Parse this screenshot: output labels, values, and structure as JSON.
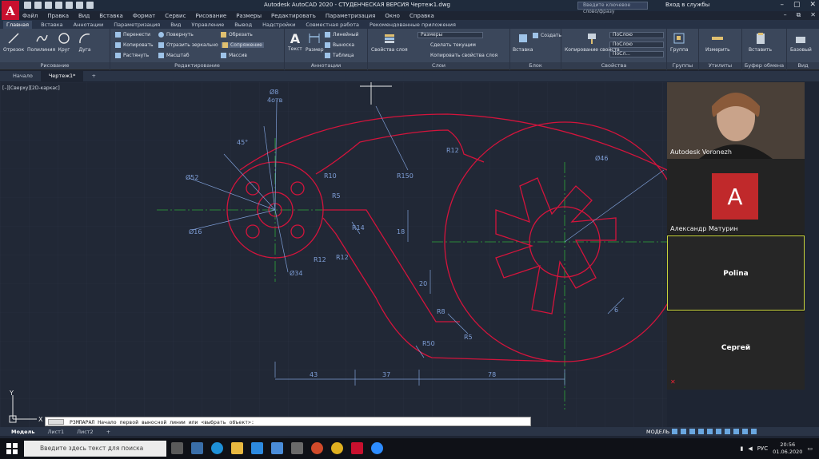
{
  "titlebar": {
    "title": "Autodesk AutoCAD 2020 - СТУДЕНЧЕСКАЯ ВЕРСИЯ    Чертеж1.dwg",
    "search_placeholder": "Введите ключевое слово/фразу",
    "signin": "Вход в службы",
    "logo": "A"
  },
  "menu": [
    "Файл",
    "Правка",
    "Вид",
    "Вставка",
    "Формат",
    "Сервис",
    "Рисование",
    "Размеры",
    "Редактировать",
    "Параметризация",
    "Окно",
    "Справка"
  ],
  "ribbon_tabs": [
    "Главная",
    "Вставка",
    "Аннотации",
    "Параметризация",
    "Вид",
    "Управление",
    "Вывод",
    "Надстройки",
    "Совместная работа",
    "Рекомендованные приложения"
  ],
  "ribbon": {
    "draw": {
      "label": "Рисование",
      "tools": [
        "Отрезок",
        "Полилиния",
        "Круг",
        "Дуга"
      ]
    },
    "modify": {
      "label": "Редактирование",
      "move": "Перенести",
      "rotate": "Повернуть",
      "trim": "Обрезать",
      "copy": "Копировать",
      "mirror": "Отразить зеркально",
      "fillet": "Сопряжение",
      "stretch": "Растянуть",
      "scale": "Масштаб",
      "array": "Массив"
    },
    "annotation": {
      "label": "Аннотации",
      "text": "Текст",
      "dimension": "Размер",
      "linear": "Линейный",
      "leader": "Выноска",
      "table": "Таблица"
    },
    "layers": {
      "label": "Слои",
      "props": "Свойства слоя",
      "dropdown": "Размеры",
      "make_current": "Сделать текущим",
      "match": "Копировать свойства слоя"
    },
    "block": {
      "label": "Блок",
      "insert": "Вставка",
      "create": "Создать"
    },
    "properties": {
      "label": "Свойства",
      "match": "Копирование свойств",
      "layer1": "ПоСлою",
      "layer2": "ПоСлою",
      "layer3": "ПоСл..."
    },
    "groups": {
      "label": "Группы",
      "group": "Группа"
    },
    "utilities": {
      "label": "Утилиты",
      "measure": "Измерить"
    },
    "clipboard": {
      "label": "Буфер обмена",
      "paste": "Вставить"
    },
    "view": {
      "label": "Вид",
      "base": "Базовый"
    }
  },
  "doc_tabs": [
    "Начало",
    "Чертеж1*"
  ],
  "canvas": {
    "view_label": "[–][Сверху][2D-каркас]",
    "dims": [
      "Ø8",
      "4отв",
      "45°",
      "Ø52",
      "Ø16",
      "Ø34",
      "R10",
      "R5",
      "R14",
      "R12",
      "R12",
      "R150",
      "R12",
      "18",
      "20",
      "R8",
      "R5",
      "R50",
      "Ø46",
      "6",
      "43",
      "37",
      "78"
    ],
    "axis_y": "Y",
    "axis_x": "X"
  },
  "video": {
    "p1": "Autodesk Voronezh",
    "p2": "Александр Матурин",
    "p2_avatar": "A",
    "p3": "Polina",
    "p4": "Сергей"
  },
  "command": {
    "prompt": "РЗМПАРАЛ Начало первой выносной линии или <выбрать объект>:"
  },
  "layout_tabs": [
    "Модель",
    "Лист1",
    "Лист2"
  ],
  "status": {
    "model": "МОДЕЛЬ"
  },
  "taskbar": {
    "search_placeholder": "Введите здесь текст для поиска",
    "lang": "РУС",
    "time": "20:56",
    "date": "01.06.2020"
  },
  "colors": {
    "accent_red": "#c8102e",
    "drawing_red": "#d4143c",
    "green_axis": "#2ea83a",
    "dim_blue": "#7f9fd8"
  }
}
